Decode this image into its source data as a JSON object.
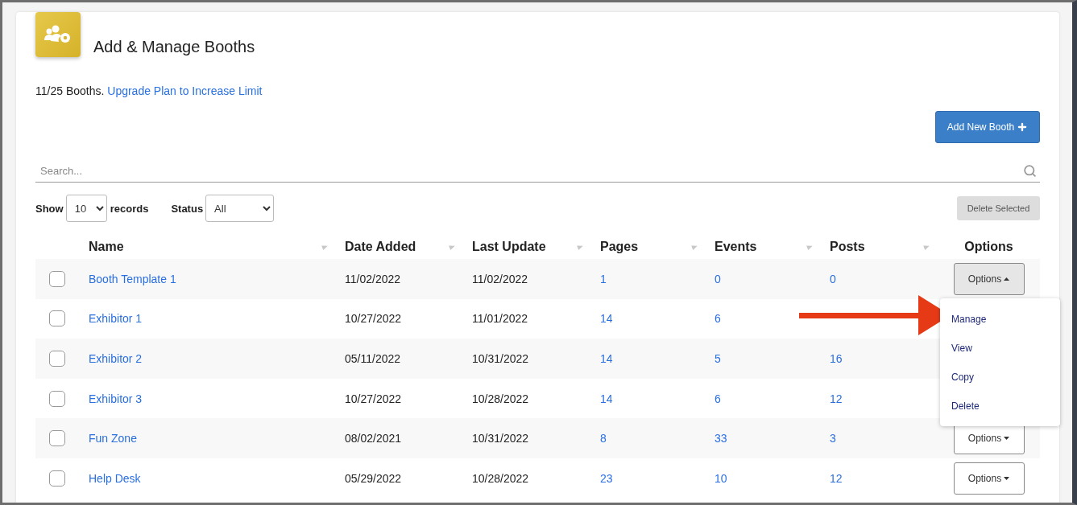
{
  "page": {
    "title": "Add & Manage Booths"
  },
  "limit": {
    "text": "11/25 Booths.",
    "link": "Upgrade Plan to Increase Limit"
  },
  "add_button": {
    "label": "Add New Booth"
  },
  "search": {
    "placeholder": "Search..."
  },
  "filters": {
    "show_label": "Show",
    "show_value": "10",
    "records_label": "records",
    "status_label": "Status",
    "status_value": "All"
  },
  "delete_button": {
    "label": "Delete Selected",
    "disabled": true
  },
  "table": {
    "columns": [
      {
        "label": "Name",
        "sortable": true
      },
      {
        "label": "Date Added",
        "sortable": true
      },
      {
        "label": "Last Update",
        "sortable": true
      },
      {
        "label": "Pages",
        "sortable": true
      },
      {
        "label": "Events",
        "sortable": true
      },
      {
        "label": "Posts",
        "sortable": true
      },
      {
        "label": "Options",
        "sortable": false
      }
    ],
    "rows": [
      {
        "checked": false,
        "name": "Booth Template 1",
        "date_added": "11/02/2022",
        "last_update": "11/02/2022",
        "pages": "1",
        "events": "0",
        "posts": "0",
        "options": {
          "label": "Options",
          "open": true,
          "menu": [
            "Manage",
            "View",
            "Copy",
            "Delete"
          ]
        }
      },
      {
        "checked": false,
        "name": "Exhibitor 1",
        "date_added": "10/27/2022",
        "last_update": "11/01/2022",
        "pages": "14",
        "events": "6"
      },
      {
        "checked": false,
        "name": "Exhibitor 2",
        "date_added": "05/11/2022",
        "last_update": "10/31/2022",
        "pages": "14",
        "events": "5",
        "posts": "16"
      },
      {
        "checked": false,
        "name": "Exhibitor 3",
        "date_added": "10/27/2022",
        "last_update": "10/28/2022",
        "pages": "14",
        "events": "6",
        "posts": "12"
      },
      {
        "checked": false,
        "name": "Fun Zone",
        "date_added": "08/02/2021",
        "last_update": "10/31/2022",
        "pages": "8",
        "events": "33",
        "posts": "3",
        "options": {
          "label": "Options",
          "open": false
        }
      },
      {
        "checked": false,
        "name": "Help Desk",
        "date_added": "05/29/2022",
        "last_update": "10/28/2022",
        "pages": "23",
        "events": "10",
        "posts": "12",
        "options": {
          "label": "Options",
          "open": false
        }
      }
    ]
  }
}
